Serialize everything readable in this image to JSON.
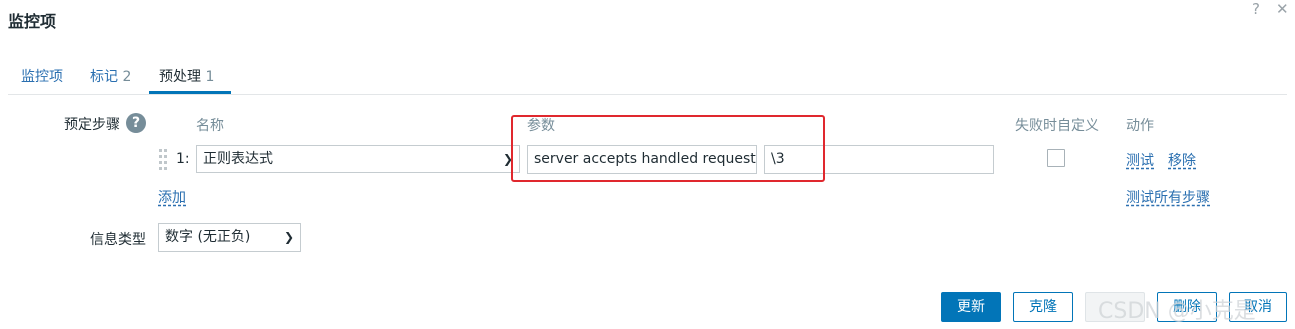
{
  "dialog": {
    "title": "监控项",
    "help_glyph": "?",
    "close_glyph": "✕"
  },
  "tabs": [
    {
      "label": "监控项",
      "count": ""
    },
    {
      "label": "标记",
      "count": "2"
    },
    {
      "label": "预处理",
      "count": "1",
      "active": true
    }
  ],
  "preprocessing": {
    "section_label": "预定步骤",
    "help_glyph": "?",
    "headers": {
      "name": "名称",
      "params": "参数",
      "custom_on_fail": "失败时自定义",
      "actions": "动作"
    },
    "steps": [
      {
        "index": "1:",
        "type": "正则表达式",
        "param1": "server accepts handled requests",
        "param2": "\\3",
        "custom_on_fail": false,
        "test_label": "测试",
        "remove_label": "移除"
      }
    ],
    "add_label": "添加",
    "test_all_label": "测试所有步骤"
  },
  "info_type": {
    "label": "信息类型",
    "value": "数字 (无正负)"
  },
  "buttons": {
    "update": "更新",
    "clone": "克隆",
    "third": "",
    "delete": "删除",
    "cancel": "取消"
  },
  "watermark": "CSDN @小克是"
}
